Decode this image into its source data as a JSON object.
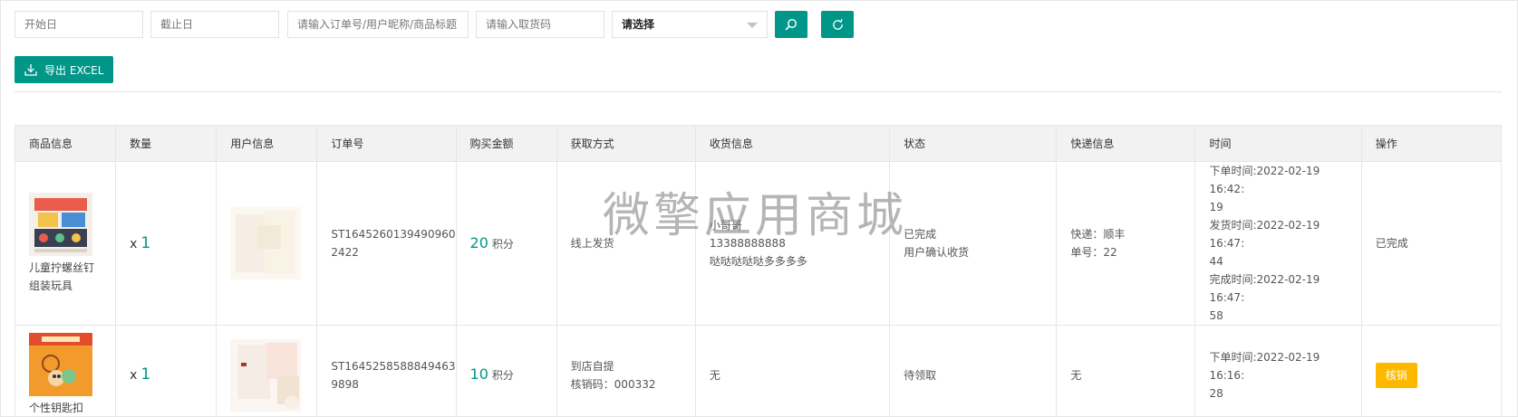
{
  "filters": {
    "start_date_placeholder": "开始日",
    "end_date_placeholder": "截止日",
    "keyword_placeholder": "请输入订单号/用户昵称/商品标题",
    "pickup_code_placeholder": "请输入取货码",
    "status_select_value": "请选择"
  },
  "toolbar": {
    "export_label": "导出 EXCEL"
  },
  "table": {
    "headers": [
      "商品信息",
      "数量",
      "用户信息",
      "订单号",
      "购买金额",
      "获取方式",
      "收货信息",
      "状态",
      "快递信息",
      "时间",
      "操作"
    ],
    "rows": [
      {
        "product_name": "儿童拧螺丝钉组装玩具",
        "qty_prefix": "x",
        "qty": "1",
        "order_no_line1": "ST1645260139490960",
        "order_no_line2": "2422",
        "amount": "20",
        "amount_unit": "积分",
        "method_line1": "线上发货",
        "method_line2": "",
        "recv_line1": "小哥哥",
        "recv_line2": "13388888888",
        "recv_line3": "哒哒哒哒哒多多多多",
        "status_line1": "已完成",
        "status_line2": "用户确认收货",
        "express_line1": "快递：顺丰",
        "express_line2": "单号：22",
        "time_line1": "下单时间:2022-02-19 16:42:",
        "time_line2": "19",
        "time_line3": "发货时间:2022-02-19 16:47:",
        "time_line4": "44",
        "time_line5": "完成时间:2022-02-19 16:47:",
        "time_line6": "58",
        "action": "已完成"
      },
      {
        "product_name": "个性钥匙扣",
        "qty_prefix": "x",
        "qty": "1",
        "order_no_line1": "ST1645258588849463",
        "order_no_line2": "9898",
        "amount": "10",
        "amount_unit": "积分",
        "method_line1": "到店自提",
        "method_line2": "核销码：000332",
        "recv_line1": "无",
        "status_line1": "待领取",
        "express_line1": "无",
        "time_line1": "下单时间:2022-02-19 16:16:",
        "time_line2": "28",
        "action": "核销"
      }
    ]
  },
  "watermark": "微擎应用商城",
  "colors": {
    "primary": "#009688",
    "warning": "#ffb800",
    "header_bg": "#f2f2f2"
  },
  "icons": [
    "search-icon",
    "refresh-icon",
    "download-icon",
    "chevron-down-icon"
  ]
}
